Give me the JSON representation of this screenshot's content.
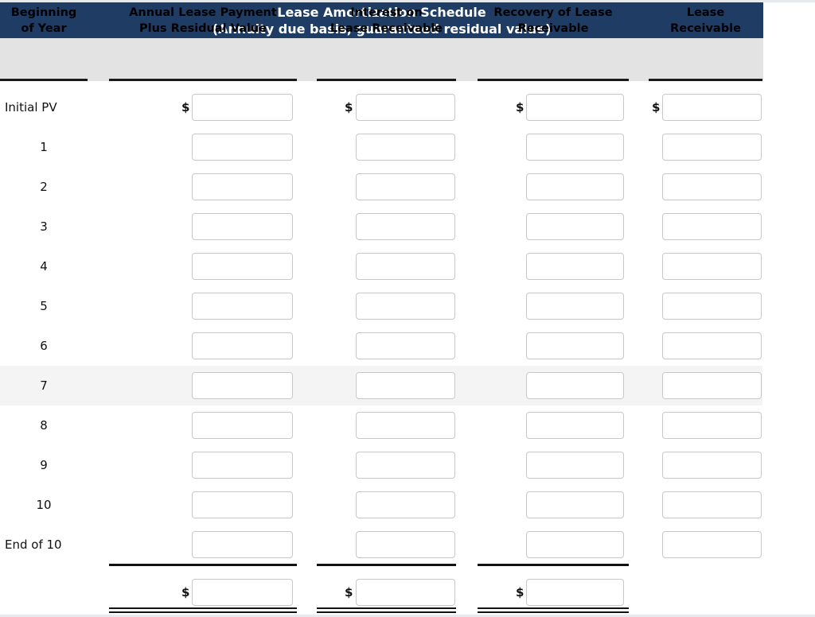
{
  "banner": {
    "title_line1": "Lease Amortization Schedule",
    "title_line2": "(Annuity due basis, guaranteed residual value)",
    "background_color": "#1e3c64",
    "text_color": "#ffffff"
  },
  "columns": [
    {
      "line1": "Beginning",
      "line2": "of Year"
    },
    {
      "line1": "Annual Lease Payment",
      "line2": "Plus Residual Value"
    },
    {
      "line1": "Interest on",
      "line2": "Lease Receivable"
    },
    {
      "line1": "Recovery of Lease",
      "line2": "Receivable"
    },
    {
      "line1": "Lease",
      "line2": "Receivable"
    }
  ],
  "currency_symbol": "$",
  "input_placeholder": "",
  "rows": [
    {
      "label": "Initial PV",
      "label_align": "left",
      "show_dollar": true,
      "inputs": [
        "",
        "",
        "",
        ""
      ],
      "shaded": false
    },
    {
      "label": "1",
      "label_align": "center",
      "show_dollar": false,
      "inputs": [
        "",
        "",
        "",
        ""
      ],
      "shaded": false
    },
    {
      "label": "2",
      "label_align": "center",
      "show_dollar": false,
      "inputs": [
        "",
        "",
        "",
        ""
      ],
      "shaded": false
    },
    {
      "label": "3",
      "label_align": "center",
      "show_dollar": false,
      "inputs": [
        "",
        "",
        "",
        ""
      ],
      "shaded": false
    },
    {
      "label": "4",
      "label_align": "center",
      "show_dollar": false,
      "inputs": [
        "",
        "",
        "",
        ""
      ],
      "shaded": false
    },
    {
      "label": "5",
      "label_align": "center",
      "show_dollar": false,
      "inputs": [
        "",
        "",
        "",
        ""
      ],
      "shaded": false
    },
    {
      "label": "6",
      "label_align": "center",
      "show_dollar": false,
      "inputs": [
        "",
        "",
        "",
        ""
      ],
      "shaded": false
    },
    {
      "label": "7",
      "label_align": "center",
      "show_dollar": false,
      "inputs": [
        "",
        "",
        "",
        ""
      ],
      "shaded": true
    },
    {
      "label": "8",
      "label_align": "center",
      "show_dollar": false,
      "inputs": [
        "",
        "",
        "",
        ""
      ],
      "shaded": false
    },
    {
      "label": "9",
      "label_align": "center",
      "show_dollar": false,
      "inputs": [
        "",
        "",
        "",
        ""
      ],
      "shaded": false
    },
    {
      "label": "10",
      "label_align": "center",
      "show_dollar": false,
      "inputs": [
        "",
        "",
        "",
        ""
      ],
      "shaded": false
    },
    {
      "label": "End of 10",
      "label_align": "left",
      "show_dollar": false,
      "inputs": [
        "",
        "",
        "",
        ""
      ],
      "shaded": false
    }
  ],
  "totals_row": {
    "label": "",
    "show_dollar": true,
    "inputs": [
      "",
      "",
      ""
    ]
  },
  "colors": {
    "header_band": "#e3e3e3",
    "shaded_row": "#f4f4f4",
    "rule": "#121212",
    "input_border": "#c8c8c8"
  }
}
